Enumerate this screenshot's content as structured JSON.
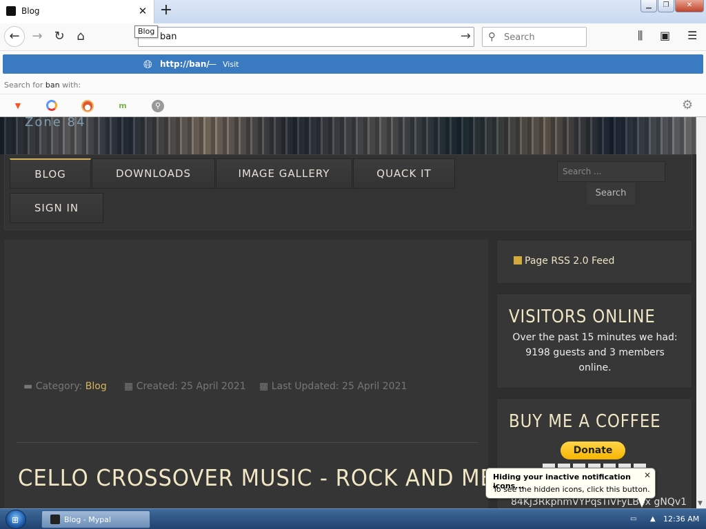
{
  "browser": {
    "tab_title": "Blog",
    "tooltip": "Blog",
    "url_value": "ban",
    "search_placeholder": "Search"
  },
  "autocomplete": {
    "url": "http://ban/",
    "separator": "—",
    "action": "Visit",
    "search_for_prefix": "Search for",
    "search_term": "ban",
    "search_for_suffix": "with:",
    "engines": [
      "brave-icon",
      "qwant-icon",
      "duckduckgo-icon",
      "mojeek-icon",
      "search-icon"
    ]
  },
  "site": {
    "banner_logo": "Zone 84",
    "nav": [
      "BLOG",
      "DOWNLOADS",
      "IMAGE GALLERY",
      "QUACK IT",
      "SIGN IN"
    ],
    "search_placeholder": "Search ...",
    "search_button": "Search"
  },
  "article": {
    "title": "CELLO CROSSOVER MUSIC - ROCK AND METAL",
    "category_label": "Category:",
    "category": "Blog",
    "created": "Created: 25 April 2021",
    "updated": "Last Updated: 25 April 2021"
  },
  "sidebar": {
    "rss": "Page RSS 2.0 Feed",
    "visitors_title": "VISITORS ONLINE",
    "visitors_text": "Over the past 15 minutes we had: 9198 guests and 3 members online.",
    "coffee_title": "BUY ME A COFFEE",
    "donate": "Donate",
    "btc_fragment": "84Kj3RkphmVYPqsTiVFyLB4x  gNQv1"
  },
  "notification": {
    "title": "Hiding your inactive notification icons...",
    "body": "To see the hidden icons, click this button."
  },
  "taskbar": {
    "task_label": "Blog - Mypal",
    "clock": "12:36 AM"
  },
  "colors": {
    "accent": "#3a7ac0",
    "site_gold": "#d6b55a",
    "site_bg": "#2e2e2e"
  }
}
